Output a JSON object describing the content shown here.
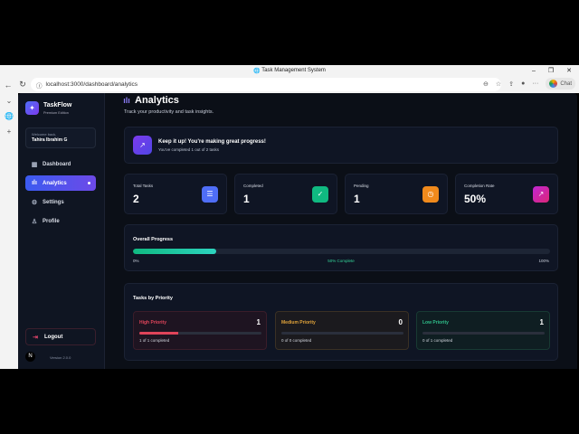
{
  "browser": {
    "title": "Task Management System",
    "url": "localhost:3000/dashboard/analytics",
    "chat_label": "Chat"
  },
  "sidebar": {
    "brand": "TaskFlow",
    "edition": "Premium Edition",
    "welcome": "Welcome back,",
    "user": "Tahira Ibrahim G",
    "items": [
      {
        "label": "Dashboard",
        "icon": "grid-icon"
      },
      {
        "label": "Analytics",
        "icon": "chart-icon",
        "active": true
      },
      {
        "label": "Settings",
        "icon": "gear-icon"
      },
      {
        "label": "Profile",
        "icon": "user-icon"
      }
    ],
    "logout": "Logout",
    "avatar_letter": "N",
    "version": "Version 2.0.0"
  },
  "main": {
    "title": "Analytics",
    "subtitle": "Track your productivity and task insights.",
    "banner": {
      "title": "Keep it up! You're making great progress!",
      "subtitle": "You've completed 1 out of 2 tasks"
    },
    "stats": [
      {
        "label": "Total Tasks",
        "value": "2",
        "color": "#4f6ef7",
        "icon": "list-icon"
      },
      {
        "label": "Completed",
        "value": "1",
        "color": "#10b981",
        "icon": "check-circle-icon"
      },
      {
        "label": "Pending",
        "value": "1",
        "color": "#f59e0b",
        "icon": "clock-icon"
      },
      {
        "label": "Completion Rate",
        "value": "50%",
        "color": "#c026d3",
        "icon": "trend-up-icon"
      }
    ],
    "progress": {
      "title": "Overall Progress",
      "min_label": "0%",
      "center_label": "50% Complete",
      "max_label": "100%",
      "bar_fill_fraction": 0.2
    },
    "priority": {
      "title": "Tasks by Priority",
      "items": [
        {
          "name": "High Priority",
          "count": "1",
          "desc": "1 of 1 completed",
          "fill_fraction": 0.32,
          "color": "#e0445a",
          "bg": "#1e1421",
          "border": "#3a1d2a"
        },
        {
          "name": "Medium Priority",
          "count": "0",
          "desc": "0 of 0 completed",
          "fill_fraction": 0,
          "color": "#e0a33a",
          "bg": "#1b1a1e",
          "border": "#3a3024"
        },
        {
          "name": "Low Priority",
          "count": "1",
          "desc": "0 of 1 completed",
          "fill_fraction": 0,
          "color": "#2fbf8a",
          "bg": "#0f1e22",
          "border": "#183a33"
        }
      ]
    }
  }
}
